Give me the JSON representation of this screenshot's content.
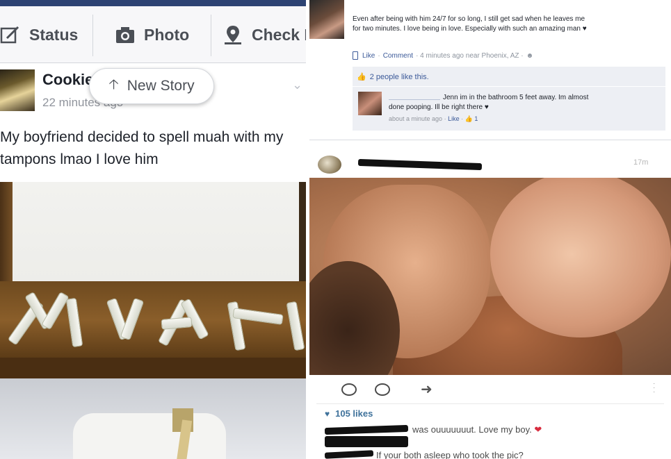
{
  "left_post": {
    "composer": {
      "status_label": "Status",
      "photo_label": "Photo",
      "checkin_label": "Check I"
    },
    "author": "Cookie",
    "timestamp": "22 minutes ago",
    "new_story_label": "New Story",
    "text": "My boyfriend decided to spell muah with my\ntampons lmao I love him",
    "accent_color": "#2d4373"
  },
  "right_top_post": {
    "status_text": "Even after being with him 24/7 for so long, I still get sad when he leaves me\nfor two minutes. I love being in love. Especially with such an amazing man ♥",
    "actions": {
      "like": "Like",
      "comment": "Comment",
      "meta": "· 4 minutes ago near Phoenix, AZ ·"
    },
    "likes_summary": "2 people like this.",
    "comment": {
      "text": "Jenn im in the bathroom 5 feet away. Im almost\ndone pooping. Ill be right there ♥",
      "time": "about a minute ago",
      "like": "Like",
      "like_count": "1"
    },
    "link_color": "#3b5998"
  },
  "right_bottom_post": {
    "time": "17m",
    "likes": "105 likes",
    "caption_visible": "was ouuuuuuut. Love my boy.",
    "comment_visible": "If your both asleep who took the pic?",
    "likes_color": "#3f729b"
  }
}
